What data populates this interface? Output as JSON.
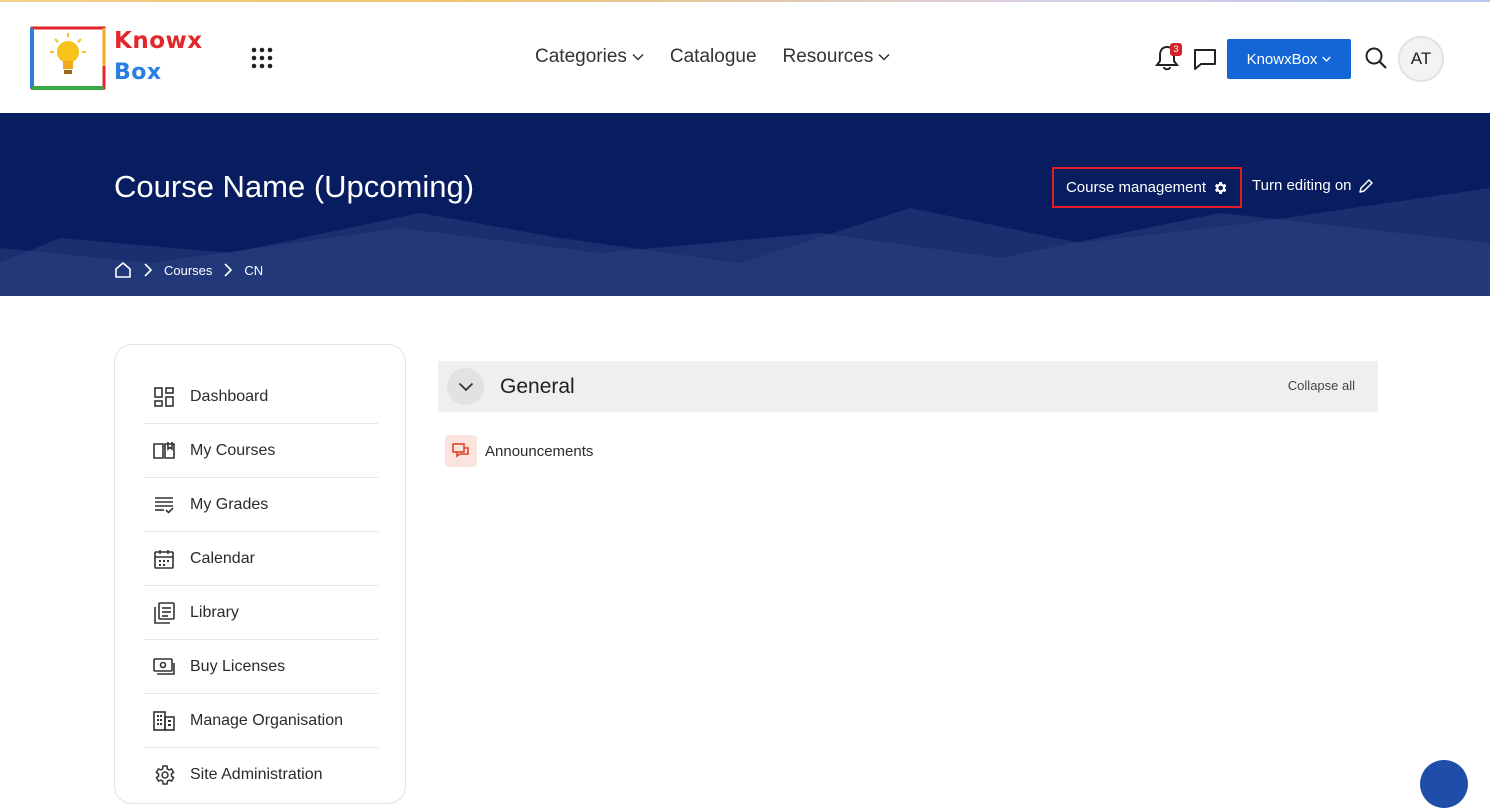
{
  "brand": {
    "logo_line1": "Knowx",
    "logo_line2": "Box"
  },
  "nav": {
    "links": [
      {
        "label": "Categories",
        "dropdown": true
      },
      {
        "label": "Catalogue",
        "dropdown": false
      },
      {
        "label": "Resources",
        "dropdown": true
      }
    ],
    "notification_count": "3",
    "workspace_button": "KnowxBox",
    "avatar_initials": "AT"
  },
  "hero": {
    "course_title": "Course Name (Upcoming)",
    "course_management": "Course management",
    "turn_editing": "Turn editing on",
    "breadcrumb": [
      "Courses",
      "CN"
    ]
  },
  "sidebar": {
    "items": [
      {
        "label": "Dashboard",
        "icon": "dashboard-icon"
      },
      {
        "label": "My Courses",
        "icon": "book-icon"
      },
      {
        "label": "My Grades",
        "icon": "grades-icon"
      },
      {
        "label": "Calendar",
        "icon": "calendar-icon"
      },
      {
        "label": "Library",
        "icon": "library-icon"
      },
      {
        "label": "Buy Licenses",
        "icon": "license-icon"
      },
      {
        "label": "Manage Organisation",
        "icon": "organisation-icon"
      },
      {
        "label": "Site Administration",
        "icon": "gear-icon"
      }
    ]
  },
  "section": {
    "title": "General",
    "collapse_all": "Collapse all",
    "activities": [
      {
        "label": "Announcements",
        "icon": "forum-icon"
      }
    ]
  },
  "colors": {
    "hero_bg": "#081d5f",
    "primary_button": "#1466d6",
    "highlight_border": "#e31b23",
    "badge": "#d1232a"
  }
}
